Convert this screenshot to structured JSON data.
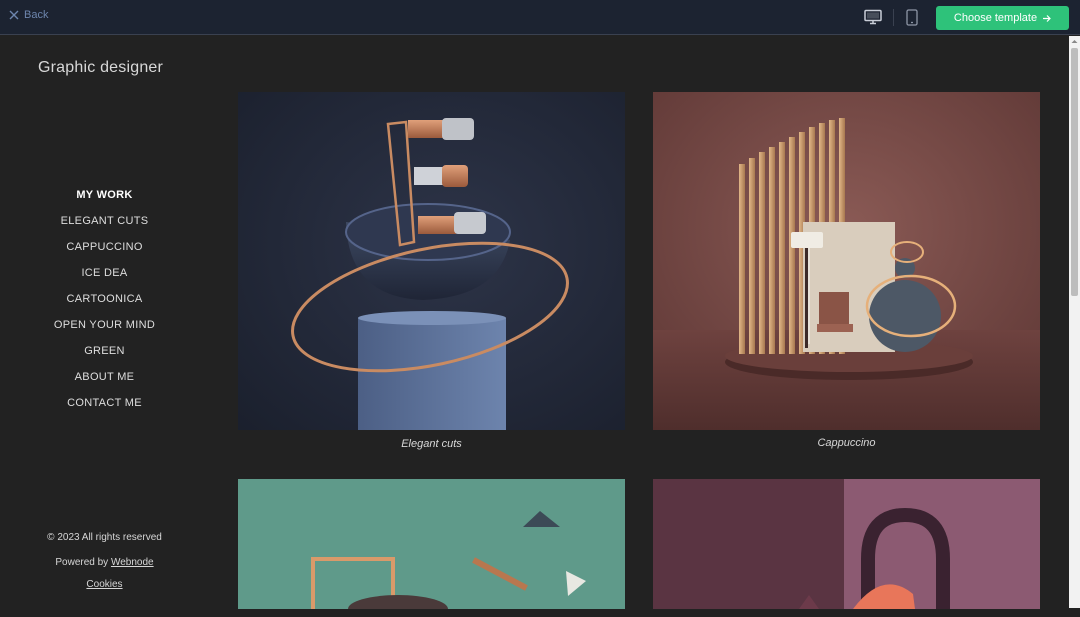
{
  "topbar": {
    "back_label": "Back",
    "back_icon": "close-icon",
    "desktop_icon": "desktop-icon",
    "mobile_icon": "mobile-icon",
    "choose_label": "Choose template",
    "choose_icon": "arrow-right-icon",
    "accent_color": "#2ec27a"
  },
  "site": {
    "title": "Graphic designer"
  },
  "nav": {
    "items": [
      {
        "label": "MY WORK",
        "active": true
      },
      {
        "label": "ELEGANT CUTS"
      },
      {
        "label": "CAPPUCCINO"
      },
      {
        "label": "ICE DEA"
      },
      {
        "label": "CARTOONICA"
      },
      {
        "label": "OPEN YOUR MIND"
      },
      {
        "label": "GREEN"
      },
      {
        "label": "ABOUT ME"
      },
      {
        "label": "CONTACT ME"
      }
    ]
  },
  "footer": {
    "copyright": "© 2023 All rights reserved",
    "powered_prefix": "Powered by ",
    "powered_link": "Webnode",
    "cookies": "Cookies"
  },
  "gallery": {
    "items": [
      {
        "caption": "Elegant cuts"
      },
      {
        "caption": "Cappuccino"
      },
      {
        "caption": ""
      },
      {
        "caption": ""
      }
    ]
  }
}
